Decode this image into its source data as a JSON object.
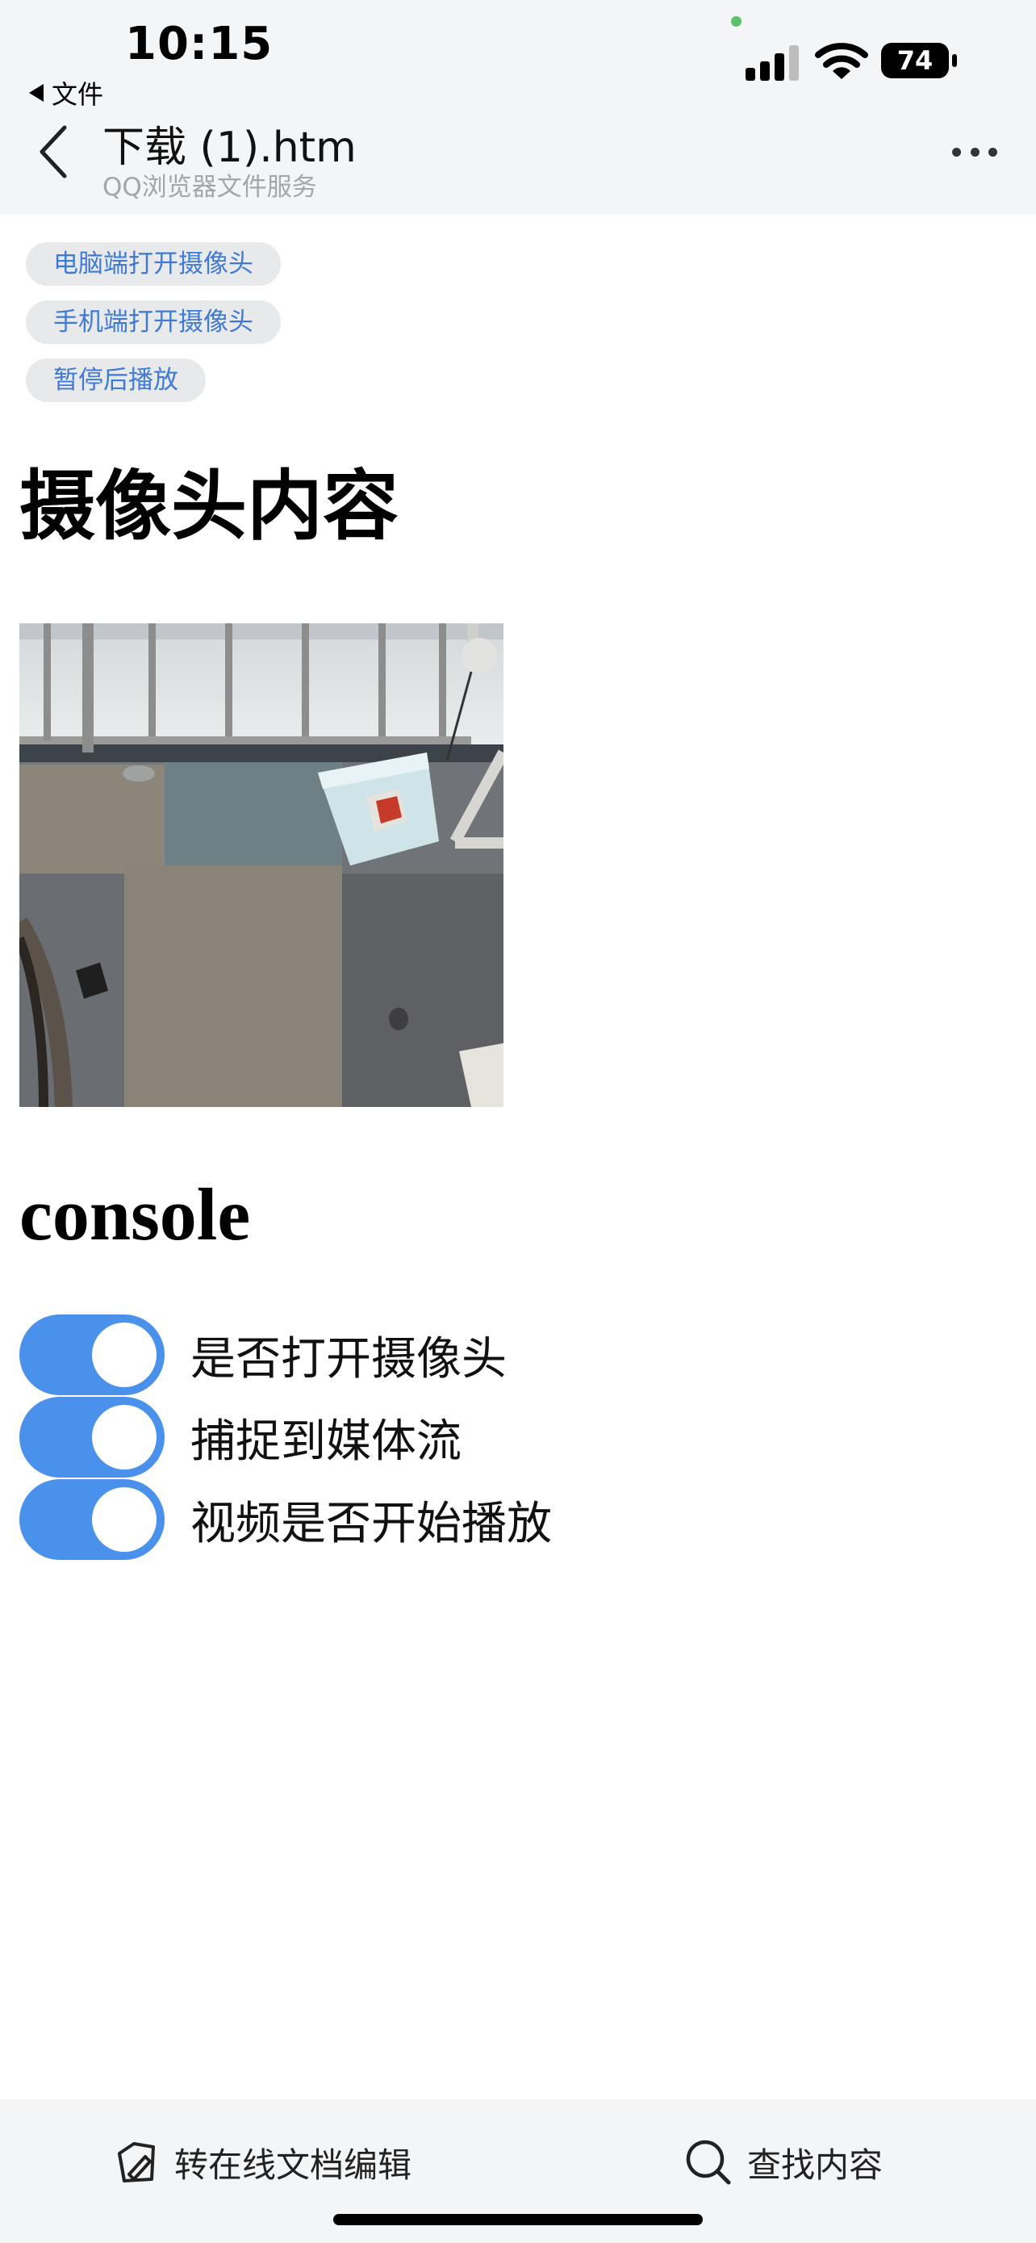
{
  "status_bar": {
    "time": "10:15",
    "back_app_label": "文件",
    "battery_level": "74"
  },
  "header": {
    "title": "下载 (1).htm",
    "subtitle": "QQ浏览器文件服务"
  },
  "buttons": [
    {
      "label": "电脑端打开摄像头"
    },
    {
      "label": "手机端打开摄像头"
    },
    {
      "label": "暂停后播放"
    }
  ],
  "camera_section": {
    "heading": "摄像头内容"
  },
  "console_section": {
    "heading": "console",
    "toggles": [
      {
        "label": "是否打开摄像头",
        "checked": true
      },
      {
        "label": "捕捉到媒体流",
        "checked": true
      },
      {
        "label": "视频是否开始播放",
        "checked": true
      }
    ]
  },
  "bottom_bar": {
    "edit_label": "转在线文档编辑",
    "search_label": "查找内容"
  },
  "colors": {
    "accent": "#4a91eb",
    "pill_text": "#3f7ad6",
    "bar_background": "#f4f5f7"
  }
}
